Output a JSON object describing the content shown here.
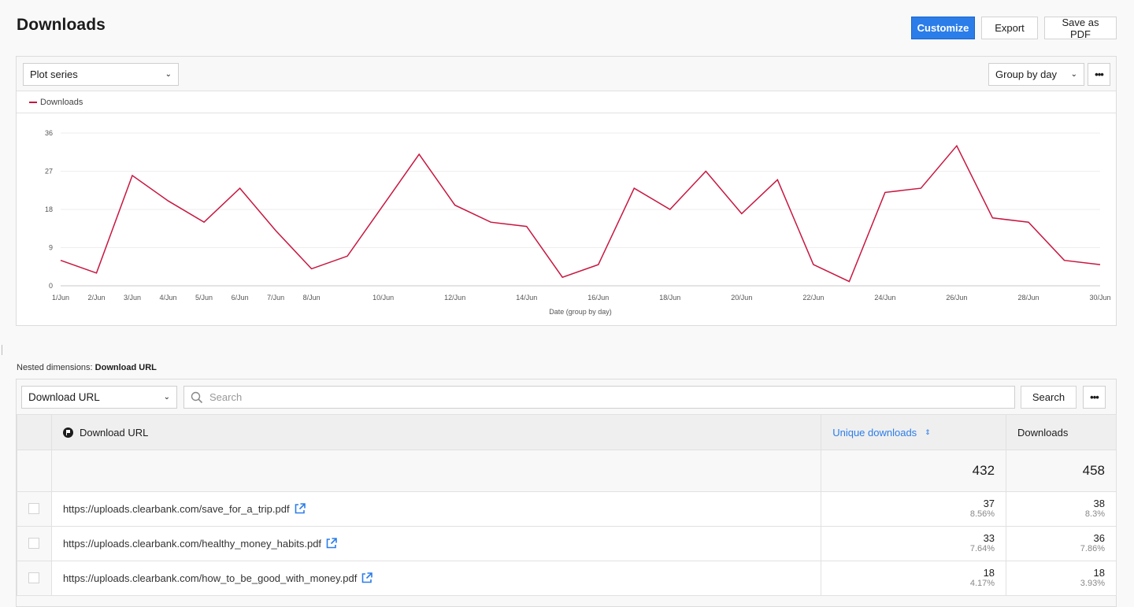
{
  "header": {
    "title": "Downloads",
    "buttons": {
      "customize": "Customize",
      "export": "Export",
      "save_pdf": "Save as PDF"
    }
  },
  "chart_panel": {
    "plot_series_label": "Plot series",
    "group_by_label": "Group by day",
    "more_label": "•••"
  },
  "chart_data": {
    "type": "line",
    "title": "",
    "legend": [
      "Downloads"
    ],
    "legend_position": "top-left",
    "xlabel": "Date (group by day)",
    "ylabel": "",
    "ylim": [
      0,
      36
    ],
    "yticks": [
      0,
      9,
      18,
      27,
      36
    ],
    "grid": true,
    "series_color": "#c8163f",
    "x": [
      "1/Jun",
      "2/Jun",
      "3/Jun",
      "4/Jun",
      "5/Jun",
      "6/Jun",
      "7/Jun",
      "8/Jun",
      "9/Jun",
      "10/Jun",
      "11/Jun",
      "12/Jun",
      "13/Jun",
      "14/Jun",
      "15/Jun",
      "16/Jun",
      "17/Jun",
      "18/Jun",
      "19/Jun",
      "20/Jun",
      "21/Jun",
      "22/Jun",
      "23/Jun",
      "24/Jun",
      "25/Jun",
      "26/Jun",
      "27/Jun",
      "28/Jun",
      "29/Jun",
      "30/Jun"
    ],
    "xtick_labels": [
      "1/Jun",
      "2/Jun",
      "3/Jun",
      "4/Jun",
      "5/Jun",
      "6/Jun",
      "7/Jun",
      "8/Jun",
      "10/Jun",
      "12/Jun",
      "14/Jun",
      "16/Jun",
      "18/Jun",
      "20/Jun",
      "22/Jun",
      "24/Jun",
      "26/Jun",
      "28/Jun",
      "30/Jun"
    ],
    "series": [
      {
        "name": "Downloads",
        "values": [
          6,
          3,
          26,
          20,
          15,
          23,
          13,
          4,
          7,
          19,
          31,
          19,
          15,
          14,
          2,
          5,
          23,
          18,
          27,
          17,
          25,
          5,
          1,
          22,
          23,
          33,
          16,
          15,
          6,
          5
        ]
      }
    ]
  },
  "nested": {
    "prefix": "Nested dimensions:",
    "value": "Download URL"
  },
  "table_toolbar": {
    "dimension_select": "Download URL",
    "search_placeholder": "Search",
    "search_button": "Search",
    "more_label": "•••"
  },
  "table": {
    "columns": {
      "url": "Download URL",
      "unique": "Unique downloads",
      "downloads": "Downloads"
    },
    "totals": {
      "unique": "432",
      "downloads": "458"
    },
    "rows": [
      {
        "url": "https://uploads.clearbank.com/save_for_a_trip.pdf",
        "unique": "37",
        "unique_pct": "8.56%",
        "downloads": "38",
        "downloads_pct": "8.3%"
      },
      {
        "url": "https://uploads.clearbank.com/healthy_money_habits.pdf",
        "unique": "33",
        "unique_pct": "7.64%",
        "downloads": "36",
        "downloads_pct": "7.86%"
      },
      {
        "url": "https://uploads.clearbank.com/how_to_be_good_with_money.pdf",
        "unique": "18",
        "unique_pct": "4.17%",
        "downloads": "18",
        "downloads_pct": "3.93%"
      }
    ]
  }
}
